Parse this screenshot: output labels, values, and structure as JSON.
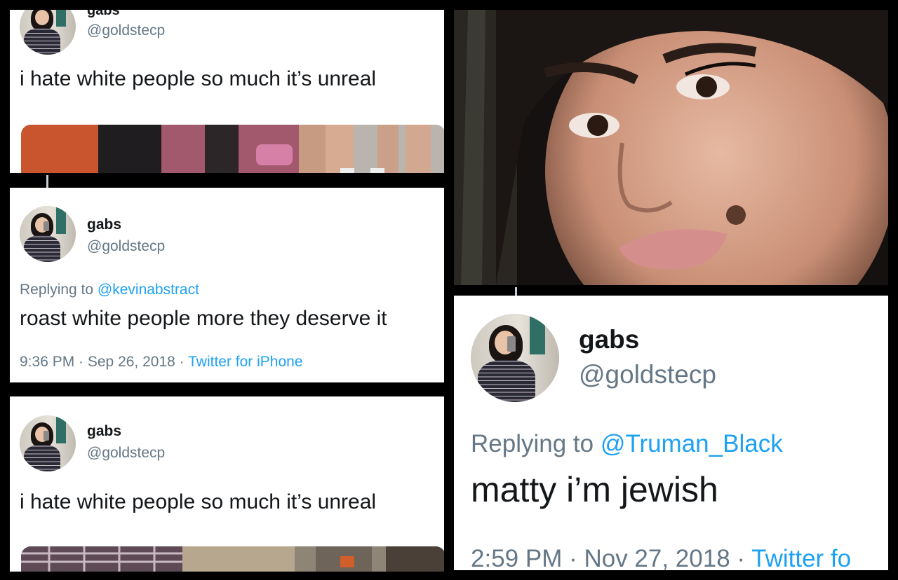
{
  "panel1": {
    "name": "gabs",
    "handle": "@goldstecp",
    "tweet": "i hate white people so much it’s unreal"
  },
  "panel2": {
    "name": "gabs",
    "handle": "@goldstecp",
    "replying_prefix": "Replying to ",
    "replying_mention": "@kevinabstract",
    "tweet": "roast white people more they deserve it",
    "time": "9:36 PM · Sep 26, 2018 · ",
    "source": "Twitter for iPhone"
  },
  "panel3": {
    "name": "gabs",
    "handle": "@goldstecp",
    "tweet": "i hate white people so much it’s unreal"
  },
  "panel4": {
    "name": "gabs",
    "handle": "@goldstecp",
    "replying_prefix": "Replying to ",
    "replying_mention": "@Truman_Black",
    "tweet": "matty i’m jewish",
    "time": "2:59 PM · Nov 27, 2018 · ",
    "source": "Twitter fo"
  },
  "colors": {
    "link": "#1da1f2",
    "secondary_text": "#657786",
    "primary_text": "#14171a",
    "background": "#000000"
  }
}
